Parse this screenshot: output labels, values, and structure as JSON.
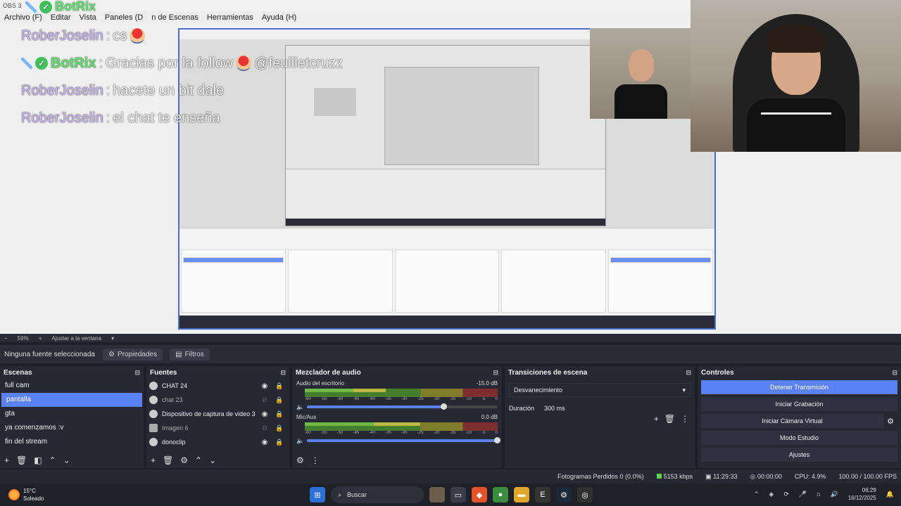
{
  "window": {
    "title": "OBS 3"
  },
  "menu": [
    "Archivo (F)",
    "Editar",
    "Vista",
    "Paneles (D",
    "n de Escenas",
    "Herramientas",
    "Ayuda (H)"
  ],
  "overlay": {
    "top_bot": "BotRix",
    "messages": [
      {
        "user": "RoberJoselin",
        "text": "cs",
        "bot": false
      },
      {
        "user": "BotRix",
        "text": "Gracias por la follow",
        "extra": "@feuilletcruzz",
        "bot": true
      },
      {
        "user": "RoberJoselin",
        "text": "hacete un bit dale",
        "bot": false
      },
      {
        "user": "RoberJoselin",
        "text": "el chat te enseña",
        "bot": false
      }
    ]
  },
  "zoom": {
    "value": "59%",
    "fit": "Ajustar a la ventana"
  },
  "source_toolbar": {
    "none": "Ninguna fuente seleccionada",
    "properties": "Propiedades",
    "filters": "Filtros"
  },
  "scenes": {
    "title": "Escenas",
    "items": [
      "full cam",
      "pantalla",
      "gta",
      "ya comenzamos :v",
      "fin del stream"
    ],
    "selected_index": 1
  },
  "sources": {
    "title": "Fuentes",
    "items": [
      {
        "name": "CHAT 24",
        "visible": true,
        "icon": "globe-icon"
      },
      {
        "name": "chat 23",
        "visible": false,
        "icon": "globe-icon"
      },
      {
        "name": "Dispositivo de captura de video 3",
        "visible": true,
        "icon": "camera-icon"
      },
      {
        "name": "Imagen 6",
        "visible": false,
        "icon": "image-icon"
      },
      {
        "name": "donoclip",
        "visible": true,
        "icon": "globe-icon"
      }
    ]
  },
  "mixer": {
    "title": "Mezclador de audio",
    "scale": [
      "-60",
      "-55",
      "-50",
      "-45",
      "-40",
      "-35",
      "-30",
      "-25",
      "-20",
      "-15",
      "-10",
      "-5",
      "0"
    ],
    "tracks": [
      {
        "name": "Audio del escritorio",
        "db": "-15.0 dB",
        "volume": 0.72,
        "level": 0.42
      },
      {
        "name": "Mic/Aux",
        "db": "0.0 dB",
        "volume": 1.0,
        "level": 0.6
      }
    ]
  },
  "transitions": {
    "title": "Transiciones de escena",
    "selected": "Desvanecimiento",
    "duration_label": "Duración",
    "duration_value": "300 ms"
  },
  "controls": {
    "title": "Controles",
    "stop_stream": "Detener Transmisión",
    "start_recording": "Iniciar Grabación",
    "virtual_cam": "Iniciar Cámara Virtual",
    "studio_mode": "Modo Estudio",
    "settings": "Ajustes"
  },
  "status": {
    "dropped": "Fotogramas Perdidos 0 (0.0%)",
    "kbps": "5153 kbps",
    "live_time": "11:29:33",
    "rec_time": "00:00:00",
    "cpu": "CPU: 4.9%",
    "fps": "100.00 / 100.00 FPS"
  },
  "taskbar": {
    "temp": "15°C",
    "weather": "Soleado",
    "search": "Buscar",
    "time": "06:29",
    "date": "16/12/2025"
  },
  "colors": {
    "accent": "#5b82f5",
    "panel": "#272834",
    "bg": "#1e1f29",
    "bot_green": "#5ddf6b",
    "user_purple": "#c9b3f7"
  }
}
